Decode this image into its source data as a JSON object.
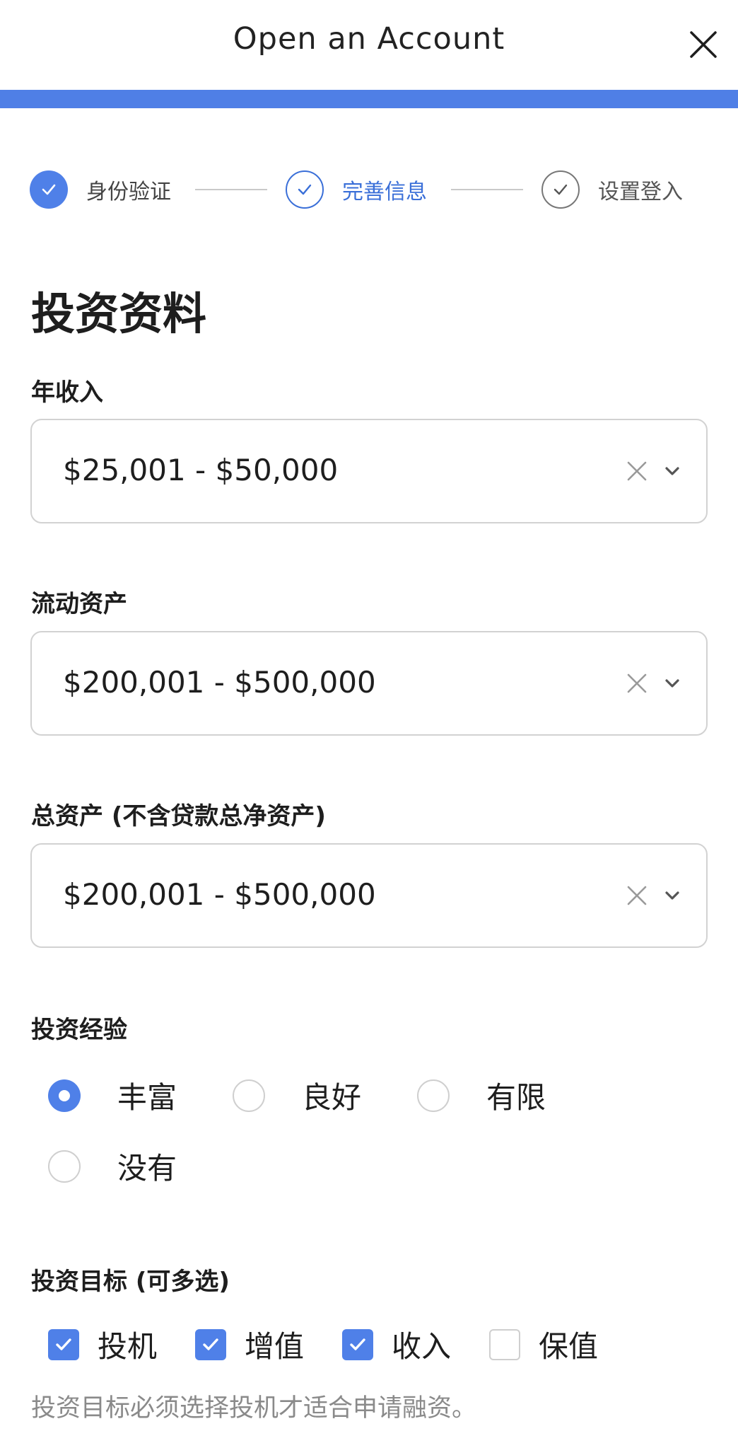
{
  "header": {
    "title": "Open an Account"
  },
  "steps": [
    {
      "label": "身份验证",
      "state": "done"
    },
    {
      "label": "完善信息",
      "state": "current"
    },
    {
      "label": "设置登入",
      "state": "pending"
    }
  ],
  "section_title": "投资资料",
  "fields": {
    "annual_income": {
      "label": "年收入",
      "value": "$25,001 - $50,000"
    },
    "liquid_assets": {
      "label": "流动资产",
      "value": "$200,001 - $500,000"
    },
    "total_assets": {
      "label": "总资产 (不含贷款总净资产)",
      "value": "$200,001 - $500,000"
    }
  },
  "experience": {
    "label": "投资经验",
    "options": [
      {
        "label": "丰富",
        "checked": true
      },
      {
        "label": "良好",
        "checked": false
      },
      {
        "label": "有限",
        "checked": false
      },
      {
        "label": "没有",
        "checked": false
      }
    ]
  },
  "goals": {
    "label": "投资目标 (可多选)",
    "options": [
      {
        "label": "投机",
        "checked": true
      },
      {
        "label": "增值",
        "checked": true
      },
      {
        "label": "收入",
        "checked": true
      },
      {
        "label": "保值",
        "checked": false
      }
    ],
    "hint": "投资目标必须选择投机才适合申请融资。"
  },
  "colors": {
    "accent": "#4f80e8",
    "border": "#d2d2d2",
    "muted": "#8a8a8a"
  },
  "icons": {
    "close": "close-icon",
    "clear": "clear-icon",
    "dropdown": "chevron-down-icon",
    "check": "check-icon"
  }
}
